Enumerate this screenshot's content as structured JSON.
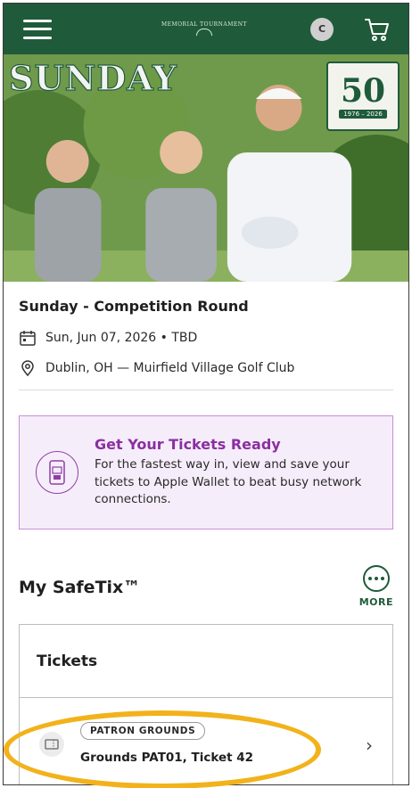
{
  "header": {
    "logo_text": "MEMORIAL TOURNAMENT",
    "avatar_initial": "C",
    "icons": {
      "menu": "hamburger-icon",
      "cart": "cart-icon"
    }
  },
  "hero": {
    "title": "SUNDAY",
    "badge_number": "50",
    "badge_years": "1976 – 2026"
  },
  "event": {
    "title": "Sunday - Competition Round",
    "date": "Sun, Jun 07, 2026 • TBD",
    "location": "Dublin, OH — Muirfield Village Golf Club"
  },
  "promo": {
    "title": "Get Your Tickets Ready",
    "body": "For the fastest way in, view and save your tickets to Apple Wallet to beat busy network connections."
  },
  "safetix": {
    "heading": "My SafeTix™",
    "more_label": "MORE"
  },
  "tickets": {
    "section_title": "Tickets",
    "items": [
      {
        "tag": "PATRON GROUNDS",
        "name": "Grounds PAT01, Ticket 42"
      }
    ]
  },
  "colors": {
    "brand_green": "#1f5b3a",
    "promo_purple": "#8a2fa0",
    "promo_bg": "#f6edfa",
    "highlight": "#f2b21b"
  }
}
